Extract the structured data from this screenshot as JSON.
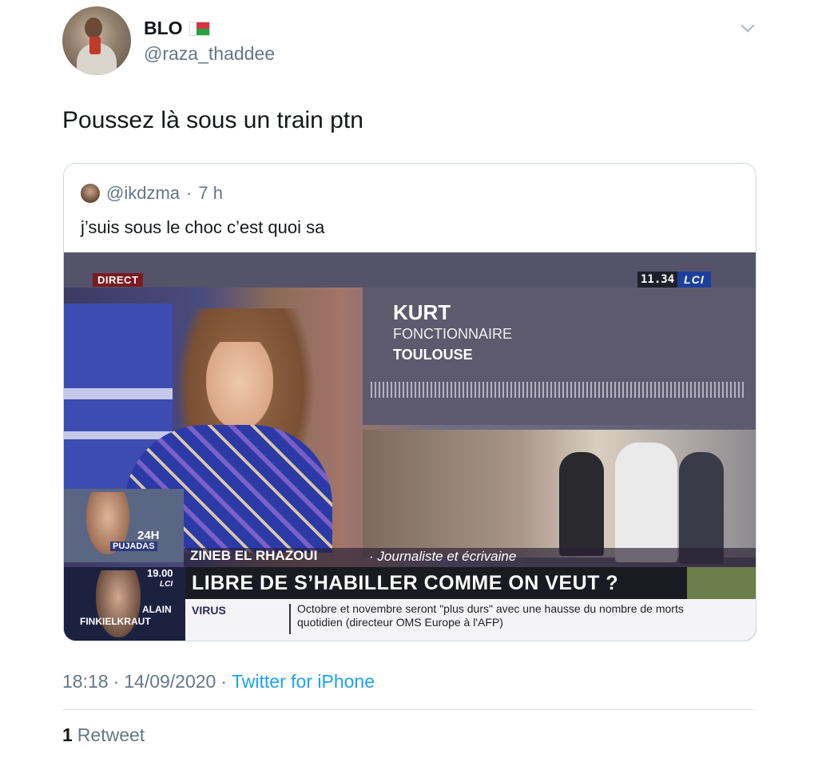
{
  "author": {
    "name": "BLO",
    "handle": "@raza_thaddee",
    "flag": "madagascar-flag-icon"
  },
  "tweet": {
    "text": "Poussez là sous un train ptn"
  },
  "quoted": {
    "handle": "@ikdzma",
    "separator": "·",
    "time": "7 h",
    "text": "j’suis sous le choc c’est quoi sa",
    "video": {
      "live_badge": "DIRECT",
      "clock": "11.34",
      "channel": "LCI",
      "guest_name": "KURT",
      "guest_job": "FONCTIONNAIRE",
      "guest_city": "TOULOUSE",
      "show_time": "24H",
      "show_name": "PUJADAS",
      "speaker": "ZINEB EL RHAZOUI",
      "speaker_sep": "·",
      "speaker_role": "Journaliste et écrivaine",
      "inset_time": "19.00",
      "inset_channel": "LCI",
      "inset_first": "ALAIN",
      "inset_last": "FINKIELKRAUT",
      "headline": "LIBRE DE S’HABILLER COMME ON VEUT ?",
      "ticker_tag": "VIRUS",
      "ticker_text": "Octobre et novembre seront \"plus durs\" avec une hausse du nombre de morts quotidien (directeur OMS Europe à l'AFP)"
    }
  },
  "meta": {
    "time": "18:18",
    "sep1": "·",
    "date": "14/09/2020",
    "sep2": "·",
    "source": "Twitter for iPhone"
  },
  "stats": {
    "retweet_count": "1",
    "retweet_label": "Retweet"
  },
  "colors": {
    "link": "#1da1f2",
    "muted": "#657786",
    "text": "#14171a"
  }
}
